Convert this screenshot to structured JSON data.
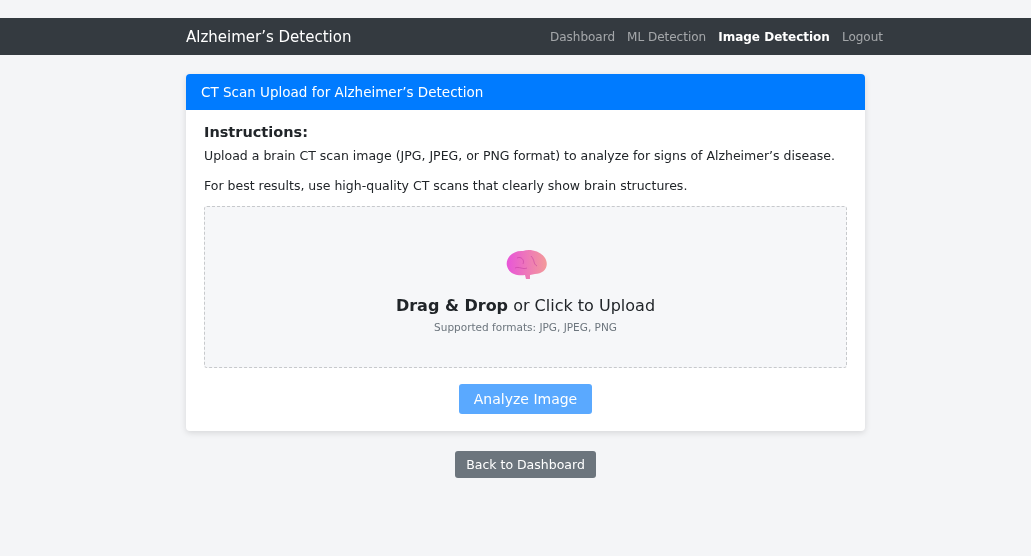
{
  "navbar": {
    "brand": "Alzheimer’s Detection",
    "links": [
      {
        "label": "Dashboard",
        "selected": false
      },
      {
        "label": "ML Detection",
        "selected": false
      },
      {
        "label": "Image Detection",
        "selected": true
      },
      {
        "label": "Logout",
        "selected": false
      }
    ]
  },
  "card": {
    "header": "CT Scan Upload for Alzheimer’s Detection",
    "instructions_title": "Instructions:",
    "paragraphs": [
      "Upload a brain CT scan image (JPG, JPEG, or PNG format) to analyze for signs of Alzheimer’s disease.",
      "For best results, use high-quality CT scans that clearly show brain structures."
    ],
    "dropzone": {
      "prompt": "**Drag & Drop** or Click to Upload",
      "formats": "Supported formats: JPG, JPEG, PNG"
    },
    "analyze_button": {
      "label": "Analyze Image",
      "disabled": true
    }
  },
  "back_button": "Back to Dashboard"
}
